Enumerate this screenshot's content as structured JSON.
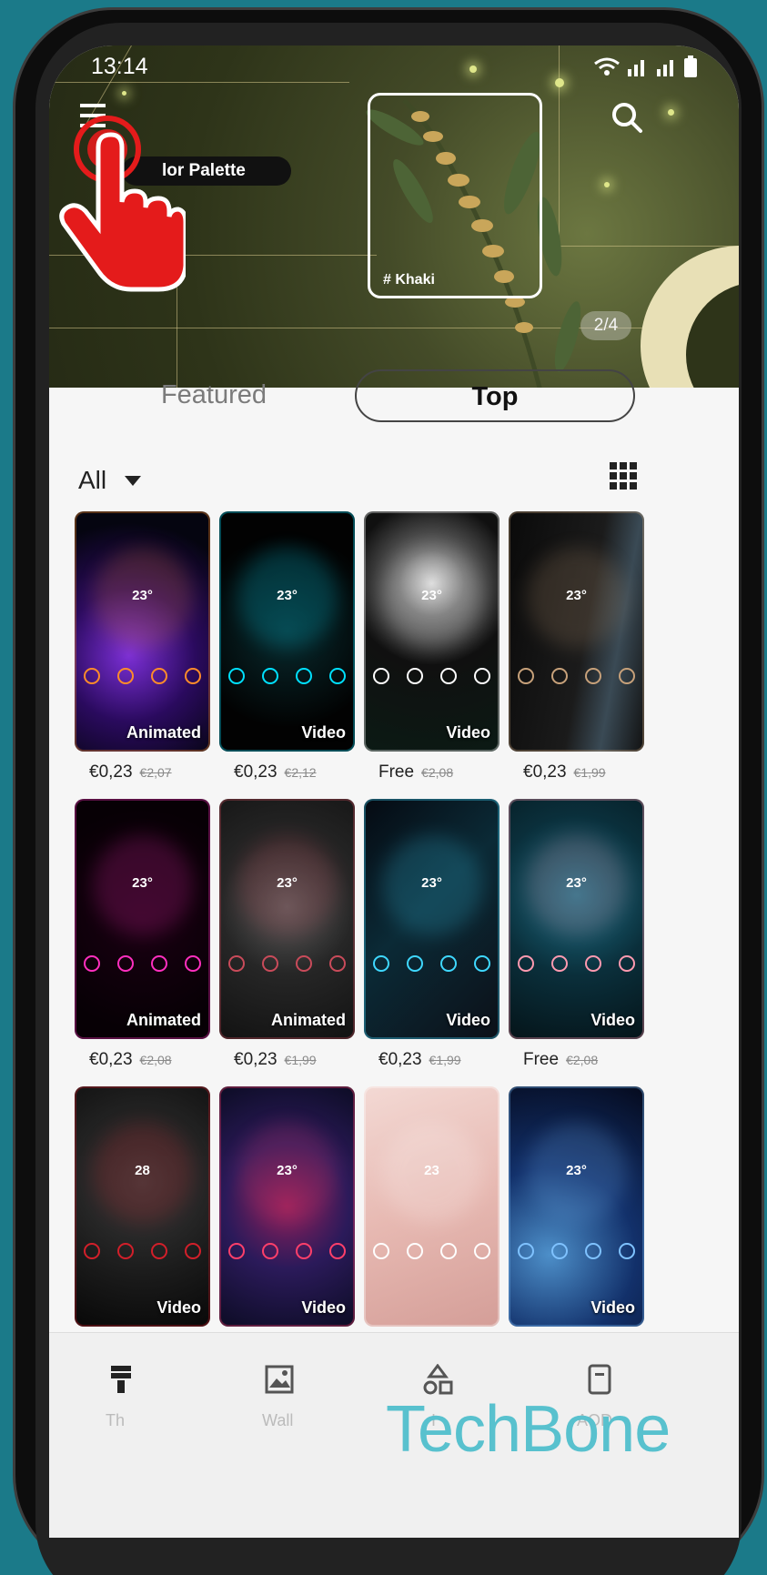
{
  "status_bar": {
    "time": "13:14"
  },
  "banner": {
    "palette_label": "lor Palette",
    "frame_label": "# Khaki",
    "page_indicator": "2/4"
  },
  "tabs": {
    "featured": "Featured",
    "top": "Top"
  },
  "filter": {
    "label": "All"
  },
  "themes": [
    {
      "badge": "Animated",
      "price": "€0,23",
      "old_price": "€2,07",
      "clock": "23°"
    },
    {
      "badge": "Video",
      "price": "€0,23",
      "old_price": "€2,12",
      "clock": "23°"
    },
    {
      "badge": "Video",
      "price": "Free",
      "old_price": "€2,08",
      "clock": "23°"
    },
    {
      "badge": "",
      "price": "€0,23",
      "old_price": "€1,99",
      "clock": "23°"
    },
    {
      "badge": "Animated",
      "price": "€0,23",
      "old_price": "€2,08",
      "clock": "23°"
    },
    {
      "badge": "Animated",
      "price": "€0,23",
      "old_price": "€1,99",
      "clock": "23°"
    },
    {
      "badge": "Video",
      "price": "€0,23",
      "old_price": "€1,99",
      "clock": "23°"
    },
    {
      "badge": "Video",
      "price": "Free",
      "old_price": "€2,08",
      "clock": "23°"
    },
    {
      "badge": "Video",
      "price": "",
      "old_price": "",
      "clock": "28"
    },
    {
      "badge": "Video",
      "price": "",
      "old_price": "",
      "clock": "23°"
    },
    {
      "badge": "",
      "price": "",
      "old_price": "",
      "clock": "23"
    },
    {
      "badge": "Video",
      "price": "",
      "old_price": "",
      "clock": "23°"
    }
  ],
  "bottom_nav": {
    "items": [
      {
        "icon": "paint-brush-icon",
        "label": "Th"
      },
      {
        "icon": "wallpaper-icon",
        "label": "Wall"
      },
      {
        "icon": "icons-icon",
        "label": "I"
      },
      {
        "icon": "aod-icon",
        "label": "AOD"
      }
    ]
  },
  "watermark": "TechBone"
}
